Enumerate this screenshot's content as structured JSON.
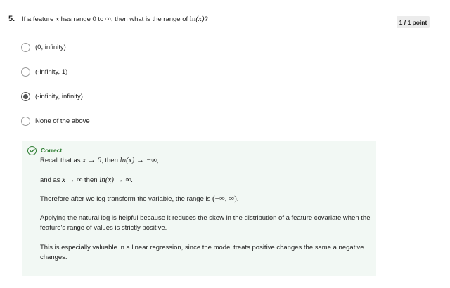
{
  "question": {
    "number": "5.",
    "text_prefix": "If a feature",
    "var": "x",
    "text_mid": "has range 0 to",
    "inf": "∞",
    "text_suffix": ", then what is the range of",
    "ln": "ln",
    "arg": "(x)",
    "end": "?"
  },
  "points": "1 / 1 point",
  "options": [
    {
      "label": "(0, infinity)",
      "selected": false
    },
    {
      "label": "(-infinity, 1)",
      "selected": false
    },
    {
      "label": "(-infinity, infinity)",
      "selected": true
    },
    {
      "label": "None of the above",
      "selected": false
    }
  ],
  "feedback": {
    "status": "Correct",
    "line1": {
      "prefix": "Recall that as",
      "m1": "x → 0",
      "mid": ", then",
      "m2": "ln(x) → −∞",
      "end": ","
    },
    "line2": {
      "prefix": "and as",
      "m1": "x → ∞",
      "mid": "then",
      "m2": "ln(x) → ∞",
      "end": "."
    },
    "line3": {
      "prefix": "Therefore after we log transform the variable, the range is",
      "m1": "(−∞, ∞)",
      "end": "."
    },
    "para1": "Applying the natural log is helpful because it reduces the skew in the distribution of a feature covariate when the feature's range of values is strictly positive.",
    "para2": "This is especially valuable in a linear regression, since the model treats positive changes the same a negative changes."
  },
  "colors": {
    "correct_green": "#2e7d32",
    "feedback_bg": "#f2f8f4",
    "radio_checked": "#555555"
  },
  "icons": {
    "correct": "check-circle-icon"
  }
}
